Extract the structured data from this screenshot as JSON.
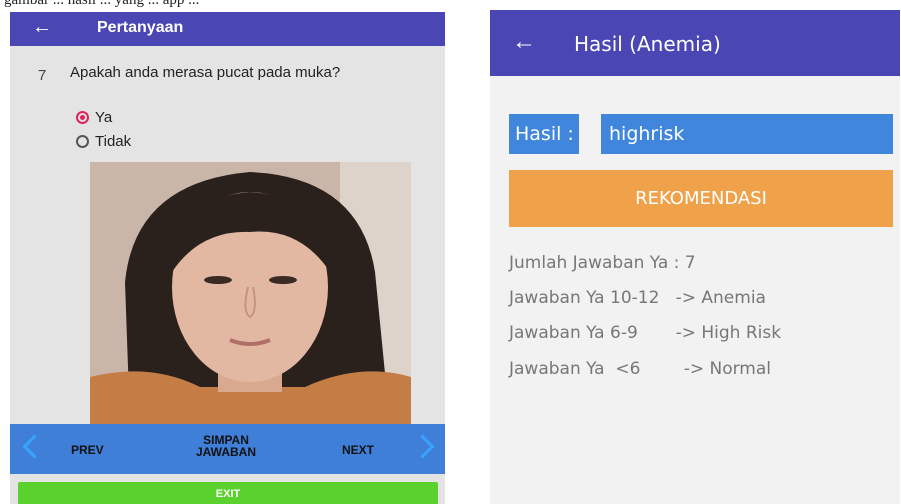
{
  "caption_fragment": "gambar ... hasil ... yang ... app ...",
  "left_screen": {
    "appbar": {
      "back_icon": "arrow-left-icon",
      "title": "Pertanyaan"
    },
    "question": {
      "number": "7",
      "text": "Apakah anda merasa pucat pada muka?"
    },
    "options": [
      {
        "label": "Ya",
        "selected": true
      },
      {
        "label": "Tidak",
        "selected": false
      }
    ],
    "photo_description": "face-photo",
    "nav": {
      "prev": "PREV",
      "save_line1": "SIMPAN",
      "save_line2": "JAWABAN",
      "next": "NEXT"
    },
    "exit": "EXIT",
    "colors": {
      "appbar": "#4a47b4",
      "nav": "#3f7fd8",
      "exit": "#5ad12c",
      "radio_selected": "#e0245e"
    }
  },
  "right_screen": {
    "appbar": {
      "back_icon": "arrow-left-icon",
      "title": "Hasil (Anemia)"
    },
    "hasil_label": "Hasil :",
    "hasil_value": "highrisk",
    "rekomendasi_button": "REKOMENDASI",
    "info_lines": [
      "Jumlah Jawaban Ya : 7",
      "Jawaban Ya 10-12   -> Anemia",
      "Jawaban Ya 6-9       -> High Risk",
      "Jawaban Ya  <6        -> Normal"
    ],
    "colors": {
      "appbar": "#4a47b4",
      "field": "#3f86dc",
      "button": "#f0a24a"
    }
  }
}
